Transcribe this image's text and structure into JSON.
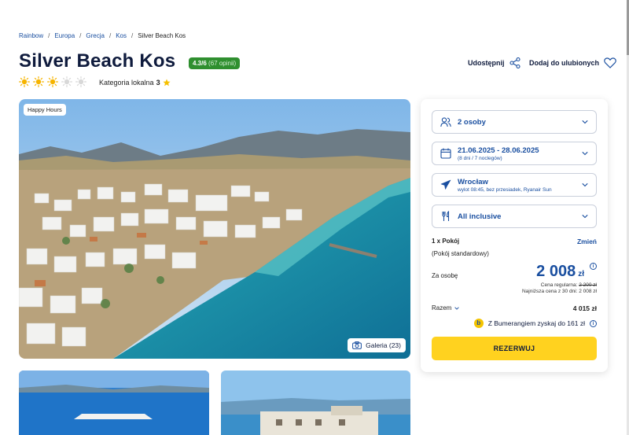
{
  "breadcrumb": [
    "Rainbow",
    "Europa",
    "Grecja",
    "Kos",
    "Silver Beach Kos"
  ],
  "hotel": {
    "title": "Silver Beach Kos",
    "rating_score": "4.3/6",
    "rating_opinions": "(67 opinii)",
    "sun_rating": 3,
    "sun_max": 5,
    "category_label": "Kategoria lokalna",
    "category_value": "3"
  },
  "actions": {
    "share_label": "Udostępnij",
    "favourite_label": "Dodaj do ulubionych"
  },
  "gallery": {
    "badge": "Happy Hours",
    "button_label": "Galeria (23)"
  },
  "booking": {
    "persons": "2 osoby",
    "dates": "21.06.2025 - 28.06.2025",
    "dates_sub": "(8 dni / 7 noclegów)",
    "departure": "Wrocław",
    "departure_sub": "wylot 08:45, bez przesiadek, Ryanair Sun",
    "board": "All inclusive",
    "room_count": "1 x Pokój",
    "room_change": "Zmień",
    "room_type": "(Pokój standardowy)",
    "per_person_label": "Za osobę",
    "price": "2 008",
    "currency": "zł",
    "regular_price_label": "Cena regularna:",
    "regular_price": "2 200 zł",
    "lowest_price": "Najniższa cena z 30 dni: 2 008 zł",
    "total_label": "Razem",
    "total_value": "4 015 zł",
    "bumerang_text": "Z Bumerangiem zyskaj do 161 zł",
    "reserve_label": "REZERWUJ"
  },
  "colors": {
    "brand_blue": "#1a4fa0",
    "rating_green": "#2f8f2f",
    "cta_yellow": "#ffd21f",
    "sun_yellow": "#f6b400"
  }
}
